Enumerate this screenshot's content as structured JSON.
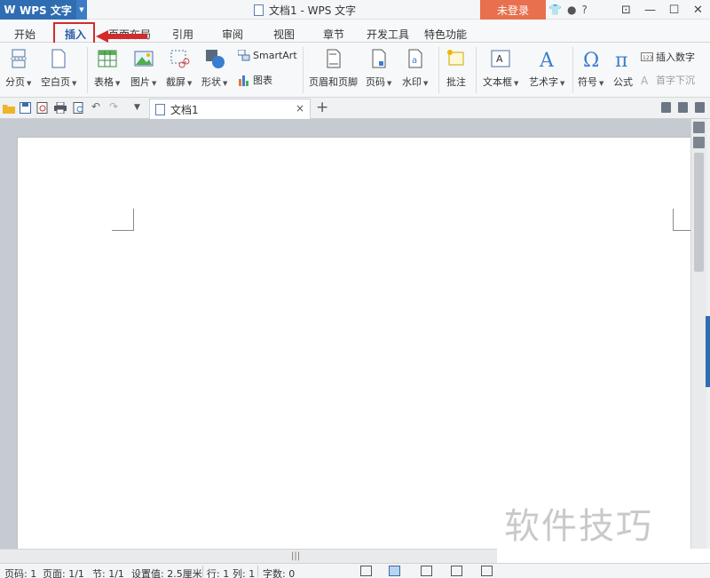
{
  "app": {
    "name": "WPS 文字"
  },
  "window": {
    "title": "文档1 - WPS 文字",
    "login_label": "未登录",
    "help_label": "?"
  },
  "menu": {
    "tabs": [
      "开始",
      "插入",
      "页面布局",
      "引用",
      "审阅",
      "视图",
      "章节",
      "开发工具",
      "特色功能"
    ],
    "active_tab": "插入"
  },
  "ribbon": {
    "page_break": "分页",
    "blank_page": "空白页",
    "table": "表格",
    "picture": "图片",
    "screenshot": "截屏",
    "shapes": "形状",
    "smartart": "SmartArt",
    "chart": "图表",
    "header_footer": "页眉和页脚",
    "page_number": "页码",
    "watermark": "水印",
    "comment": "批注",
    "textbox": "文本框",
    "wordart": "艺术字",
    "symbol": "符号",
    "formula": "公式",
    "insert_number": "插入数字",
    "drop_cap": "首字下沉"
  },
  "doc_tab": {
    "label": "文档1",
    "close": "×",
    "add": "+"
  },
  "status": {
    "page_no": "页码: 1",
    "pages": "页面: 1/1",
    "section": "节: 1/1",
    "position": "设置值: 2.5厘米",
    "line": "行: 1",
    "column": "列: 1",
    "word_count": "字数: 0"
  },
  "watermark_text": "软件技巧",
  "colors": {
    "brand": "#2f6db3",
    "login": "#e8704f",
    "highlight": "#d22b2b"
  }
}
